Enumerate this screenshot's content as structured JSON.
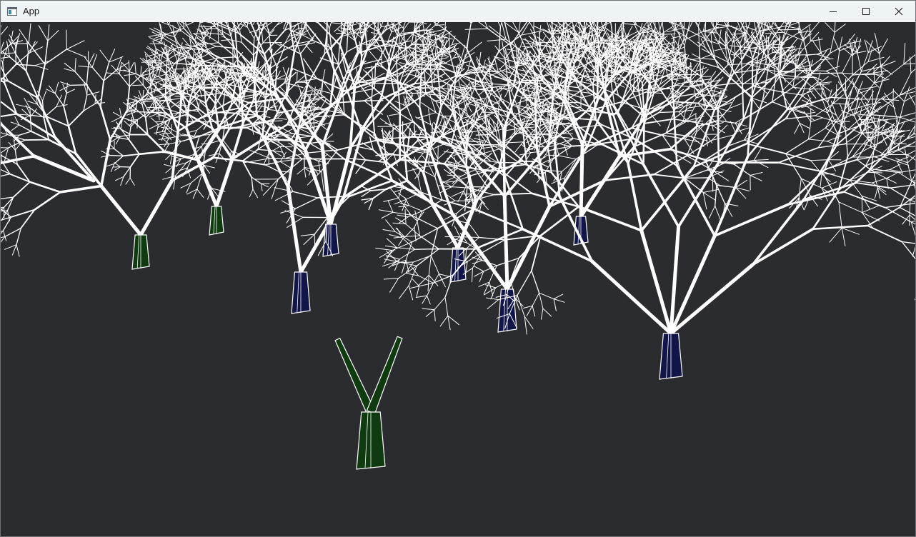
{
  "window": {
    "title": "App",
    "icons": {
      "app": "app-window-icon",
      "minimize": "minimize-icon",
      "maximize": "maximize-icon",
      "close": "close-icon"
    }
  },
  "scene": {
    "background": "#2b2c30",
    "line_color": "#ffffff",
    "trunk_colors": {
      "green": "#103b10",
      "blue": "#111548"
    }
  }
}
